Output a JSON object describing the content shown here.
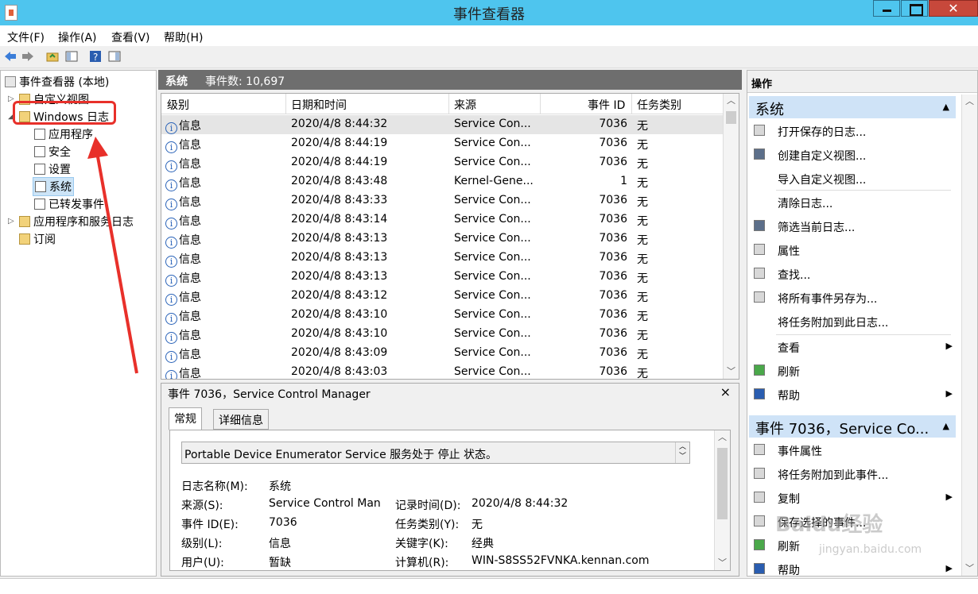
{
  "window": {
    "title": "事件查看器"
  },
  "menu": [
    "文件(F)",
    "操作(A)",
    "查看(V)",
    "帮助(H)"
  ],
  "tree": {
    "root": "事件查看器 (本地)",
    "custom_views": "自定义视图",
    "windows_logs": "Windows 日志",
    "windows_children": [
      "应用程序",
      "安全",
      "设置",
      "系统",
      "已转发事件"
    ],
    "app_service_logs": "应用程序和服务日志",
    "subscriptions": "订阅"
  },
  "center": {
    "log_name": "系统",
    "event_count": "事件数: 10,697",
    "columns": [
      "级别",
      "日期和时间",
      "来源",
      "事件 ID",
      "任务类别"
    ],
    "rows": [
      [
        "信息",
        "2020/4/8 8:44:32",
        "Service Con...",
        "7036",
        "无"
      ],
      [
        "信息",
        "2020/4/8 8:44:19",
        "Service Con...",
        "7036",
        "无"
      ],
      [
        "信息",
        "2020/4/8 8:44:19",
        "Service Con...",
        "7036",
        "无"
      ],
      [
        "信息",
        "2020/4/8 8:43:48",
        "Kernel-Gene...",
        "1",
        "无"
      ],
      [
        "信息",
        "2020/4/8 8:43:33",
        "Service Con...",
        "7036",
        "无"
      ],
      [
        "信息",
        "2020/4/8 8:43:14",
        "Service Con...",
        "7036",
        "无"
      ],
      [
        "信息",
        "2020/4/8 8:43:13",
        "Service Con...",
        "7036",
        "无"
      ],
      [
        "信息",
        "2020/4/8 8:43:13",
        "Service Con...",
        "7036",
        "无"
      ],
      [
        "信息",
        "2020/4/8 8:43:13",
        "Service Con...",
        "7036",
        "无"
      ],
      [
        "信息",
        "2020/4/8 8:43:12",
        "Service Con...",
        "7036",
        "无"
      ],
      [
        "信息",
        "2020/4/8 8:43:10",
        "Service Con...",
        "7036",
        "无"
      ],
      [
        "信息",
        "2020/4/8 8:43:10",
        "Service Con...",
        "7036",
        "无"
      ],
      [
        "信息",
        "2020/4/8 8:43:09",
        "Service Con...",
        "7036",
        "无"
      ],
      [
        "信息",
        "2020/4/8 8:43:03",
        "Service Con...",
        "7036",
        "无"
      ]
    ]
  },
  "detail": {
    "title": "事件 7036，Service Control Manager",
    "close": "×",
    "tabs": [
      "常规",
      "详细信息"
    ],
    "message": "Portable Device Enumerator Service 服务处于 停止 状态。",
    "fields": {
      "log_name_label": "日志名称(M):",
      "log_name": "系统",
      "source_label": "来源(S):",
      "source": "Service Control Man",
      "logged_label": "记录时间(D):",
      "logged": "2020/4/8 8:44:32",
      "event_id_label": "事件 ID(E):",
      "event_id": "7036",
      "task_label": "任务类别(Y):",
      "task": "无",
      "level_label": "级别(L):",
      "level": "信息",
      "keywords_label": "关键字(K):",
      "keywords": "经典",
      "user_label": "用户(U):",
      "user": "暂缺",
      "computer_label": "计算机(R):",
      "computer": "WIN-S8SS52FVNKA.kennan.com"
    }
  },
  "actions": {
    "header": "操作",
    "section1": "系统",
    "items1": [
      "打开保存的日志...",
      "创建自定义视图...",
      "导入自定义视图...",
      "清除日志...",
      "筛选当前日志...",
      "属性",
      "查找...",
      "将所有事件另存为...",
      "将任务附加到此日志...",
      "查看",
      "刷新",
      "帮助"
    ],
    "section2": "事件 7036，Service Co...",
    "items2": [
      "事件属性",
      "将任务附加到此事件...",
      "复制",
      "保存选择的事件...",
      "刷新",
      "帮助"
    ]
  },
  "watermark": {
    "text": "Baidu经验",
    "sub": "jingyan.baidu.com"
  }
}
